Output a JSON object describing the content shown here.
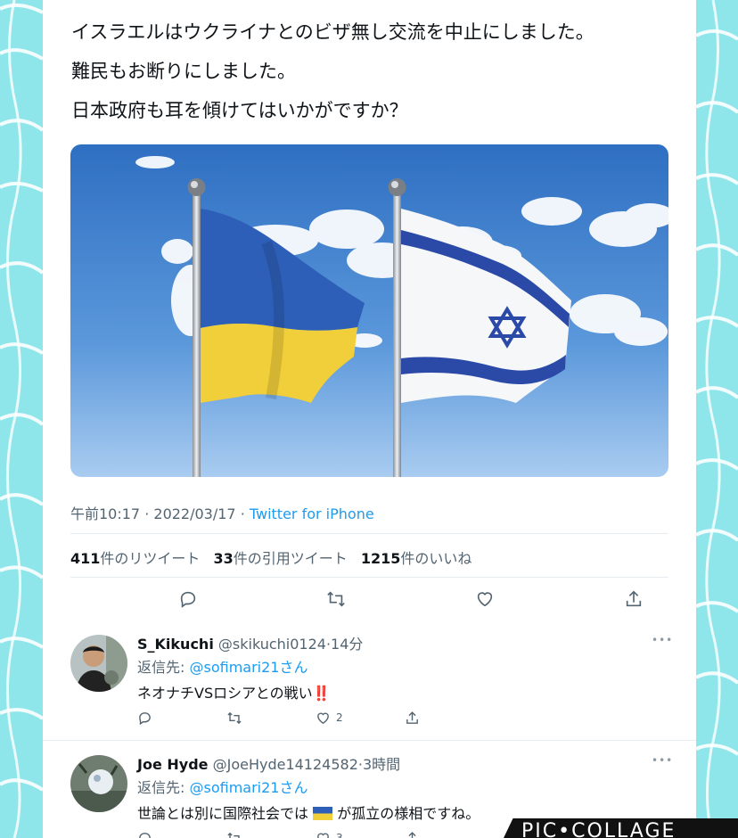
{
  "tweet": {
    "lines": [
      "イスラエルはウクライナとのビザ無し交流を中止にしました。",
      "難民もお断りにしました。",
      "日本政府も耳を傾けてはいかがですか？"
    ],
    "time": "午前10:17",
    "date": "2022/03/17",
    "source": "Twitter for iPhone",
    "retweets": {
      "count": "411",
      "label": "件のリツイート"
    },
    "quotes": {
      "count": "33",
      "label": "件の引用ツイート"
    },
    "likes": {
      "count": "1215",
      "label": "件のいいね"
    }
  },
  "replies": [
    {
      "name": "S_Kikuchi",
      "handle": "@skikuchi0124",
      "time": "14分",
      "reply_to_label": "返信先:",
      "reply_to": "@sofimari21さん",
      "text": "ネオナチVSロシアとの戦い",
      "emoji": "‼️",
      "likes": "2"
    },
    {
      "name": "Joe Hyde",
      "handle": "@JoeHyde14124582",
      "time": "3時間",
      "reply_to_label": "返信先:",
      "reply_to": "@sofimari21さん",
      "text_before": "世論とは別に国際社会では",
      "text_after": "が孤立の様相ですね。",
      "likes": "3"
    }
  ],
  "watermark": "PIC•COLLAGE",
  "colors": {
    "background": "#8ee6ea",
    "link": "#1d9bf0",
    "text": "#0f1419",
    "muted": "#536471"
  }
}
